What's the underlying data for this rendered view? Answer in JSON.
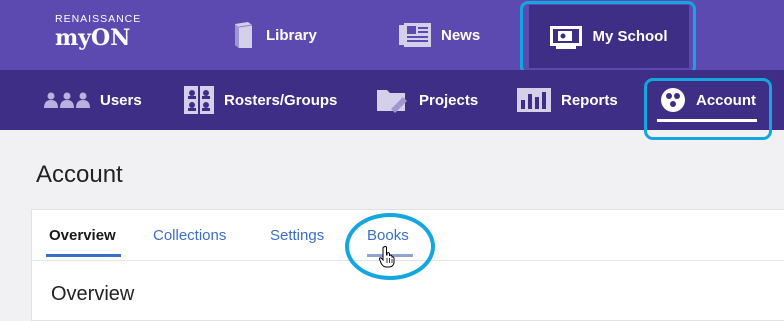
{
  "brand": {
    "line1": "RENAISSANCE",
    "line2": "myON"
  },
  "topnav": {
    "library": {
      "label": "Library",
      "icon": "book-icon"
    },
    "news": {
      "label": "News",
      "icon": "newspaper-icon"
    },
    "myschool": {
      "label": "My School",
      "icon": "school-icon"
    }
  },
  "subnav": {
    "users": {
      "label": "Users",
      "icon": "users-icon"
    },
    "rosters": {
      "label": "Rosters/Groups",
      "icon": "rosters-icon"
    },
    "projects": {
      "label": "Projects",
      "icon": "folder-edit-icon"
    },
    "reports": {
      "label": "Reports",
      "icon": "bar-chart-icon"
    },
    "account": {
      "label": "Account",
      "icon": "account-icon"
    }
  },
  "page": {
    "title": "Account"
  },
  "tabs": {
    "overview": "Overview",
    "collections": "Collections",
    "settings": "Settings",
    "books": "Books"
  },
  "section": {
    "title": "Overview"
  },
  "colors": {
    "topbar": "#5d4ab0",
    "subbar": "#3f2e86",
    "highlight": "#14a6e0",
    "tab_link": "#3b6ec8"
  }
}
